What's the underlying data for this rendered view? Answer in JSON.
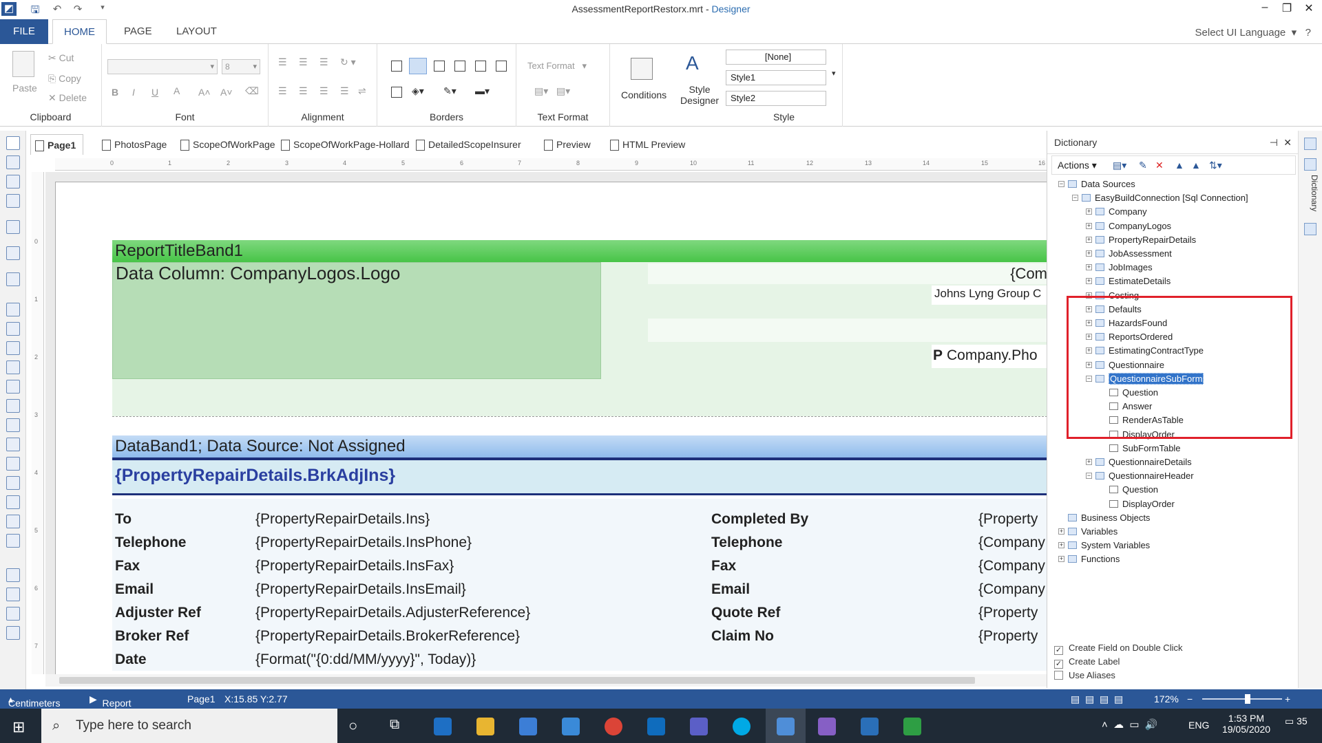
{
  "window": {
    "file_name": "AssessmentReportRestorx.mrt",
    "sep": " - ",
    "app_name": "Designer"
  },
  "ribbon_tabs": [
    "FILE",
    "HOME",
    "PAGE",
    "LAYOUT"
  ],
  "ui_language": "Select UI Language",
  "clipboard": {
    "paste": "Paste",
    "cut": "Cut",
    "copy": "Copy",
    "delete": "Delete",
    "label": "Clipboard"
  },
  "font": {
    "size": "8",
    "label": "Font",
    "bold": "B",
    "italic": "I",
    "underline": "U",
    "color": "A"
  },
  "alignment": {
    "label": "Alignment"
  },
  "borders": {
    "label": "Borders"
  },
  "text_format": {
    "value": "Text Format",
    "label": "Text Format"
  },
  "conditions": "Conditions",
  "style_designer": "Style Designer",
  "style": {
    "none": "[None]",
    "style1": "Style1",
    "style2": "Style2",
    "label": "Style"
  },
  "page_tabs": [
    "Page1",
    "PhotosPage",
    "ScopeOfWorkPage",
    "ScopeOfWorkPage-Hollard",
    "DetailedScopeInsurer",
    "Preview",
    "HTML Preview"
  ],
  "ruler": [
    "0",
    "1",
    "2",
    "3",
    "4",
    "5",
    "6",
    "7",
    "8",
    "9",
    "10",
    "11",
    "12",
    "13",
    "14",
    "15",
    "16"
  ],
  "vruler": [
    "0",
    "1",
    "2",
    "3",
    "4",
    "5",
    "6",
    "7"
  ],
  "report": {
    "title_band": "ReportTitleBand1",
    "logo_column": "Data Column: CompanyLogos.Logo",
    "com_field": "{Com",
    "company_name": "Johns Lyng Group C",
    "phone_p": "P",
    "company_phone": "Company.Pho",
    "data_band": "DataBand1; Data Source: Not Assigned",
    "brk": "{PropertyRepairDetails.BrkAdjIns}",
    "rows": [
      {
        "label": "To",
        "value": "{PropertyRepairDetails.Ins}",
        "label2": "Completed By",
        "value2": "{Property"
      },
      {
        "label": "Telephone",
        "value": "{PropertyRepairDetails.InsPhone}",
        "label2": "Telephone",
        "value2": "{Company"
      },
      {
        "label": "Fax",
        "value": "{PropertyRepairDetails.InsFax}",
        "label2": "Fax",
        "value2": "{Company"
      },
      {
        "label": "Email",
        "value": "{PropertyRepairDetails.InsEmail}",
        "label2": "Email",
        "value2": "{Company"
      },
      {
        "label": "Adjuster Ref",
        "value": "{PropertyRepairDetails.AdjusterReference}",
        "label2": "Quote Ref",
        "value2": "{Property"
      },
      {
        "label": "Broker Ref",
        "value": "{PropertyRepairDetails.BrokerReference}",
        "label2": "Claim No",
        "value2": "{Property"
      },
      {
        "label": "Date",
        "value": "{Format(\"{0:dd/MM/yyyy}\", Today)}",
        "label2": "",
        "value2": ""
      }
    ]
  },
  "dictionary": {
    "title": "Dictionary",
    "actions": "Actions",
    "tree": [
      {
        "text": "Data Sources",
        "level": 0,
        "exp": "−"
      },
      {
        "text": "EasyBuildConnection [Sql Connection]",
        "level": 1,
        "exp": "−"
      },
      {
        "text": "Company",
        "level": 2,
        "exp": "+"
      },
      {
        "text": "CompanyLogos",
        "level": 2,
        "exp": "+"
      },
      {
        "text": "PropertyRepairDetails",
        "level": 2,
        "exp": "+"
      },
      {
        "text": "JobAssessment",
        "level": 2,
        "exp": "+"
      },
      {
        "text": "JobImages",
        "level": 2,
        "exp": "+"
      },
      {
        "text": "EstimateDetails",
        "level": 2,
        "exp": "+"
      },
      {
        "text": "Costing",
        "level": 2,
        "exp": "+"
      },
      {
        "text": "Defaults",
        "level": 2,
        "exp": "+"
      },
      {
        "text": "HazardsFound",
        "level": 2,
        "exp": "+"
      },
      {
        "text": "ReportsOrdered",
        "level": 2,
        "exp": "+"
      },
      {
        "text": "EstimatingContractType",
        "level": 2,
        "exp": "+"
      },
      {
        "text": "Questionnaire",
        "level": 2,
        "exp": "+"
      },
      {
        "text": "QuestionnaireSubForm",
        "level": 2,
        "exp": "−",
        "selected": true
      },
      {
        "text": "Question",
        "level": 3,
        "exp": "",
        "icon": "abl"
      },
      {
        "text": "Answer",
        "level": 3,
        "exp": "",
        "icon": "abl"
      },
      {
        "text": "RenderAsTable",
        "level": 3,
        "exp": "",
        "icon": "chk"
      },
      {
        "text": "DisplayOrder",
        "level": 3,
        "exp": "",
        "icon": "123"
      },
      {
        "text": "SubFormTable",
        "level": 3,
        "exp": "",
        "icon": "123"
      },
      {
        "text": "QuestionnaireDetails",
        "level": 2,
        "exp": "+"
      },
      {
        "text": "QuestionnaireHeader",
        "level": 2,
        "exp": "−"
      },
      {
        "text": "Question",
        "level": 3,
        "exp": "",
        "icon": "abl"
      },
      {
        "text": "DisplayOrder",
        "level": 3,
        "exp": "",
        "icon": "123"
      },
      {
        "text": "Business Objects",
        "level": 0,
        "exp": ""
      },
      {
        "text": "Variables",
        "level": 0,
        "exp": "+"
      },
      {
        "text": "System Variables",
        "level": 0,
        "exp": "+"
      },
      {
        "text": "Functions",
        "level": 0,
        "exp": "+"
      }
    ],
    "options": [
      {
        "text": "Create Field on Double Click",
        "checked": true
      },
      {
        "text": "Create Label",
        "checked": true
      },
      {
        "text": "Use Aliases",
        "checked": false
      }
    ],
    "side_tab": "Dictionary"
  },
  "highlight_color": "#e0202a",
  "status": {
    "units": "Centimeters",
    "checker": "Report Checker",
    "page": "Page1",
    "coords": "X:15.85  Y:2.77",
    "zoom": "172%"
  },
  "taskbar": {
    "search": "Type here to search",
    "lang": "ENG",
    "time": "1:53 PM",
    "date": "19/05/2020",
    "notif": "35"
  }
}
